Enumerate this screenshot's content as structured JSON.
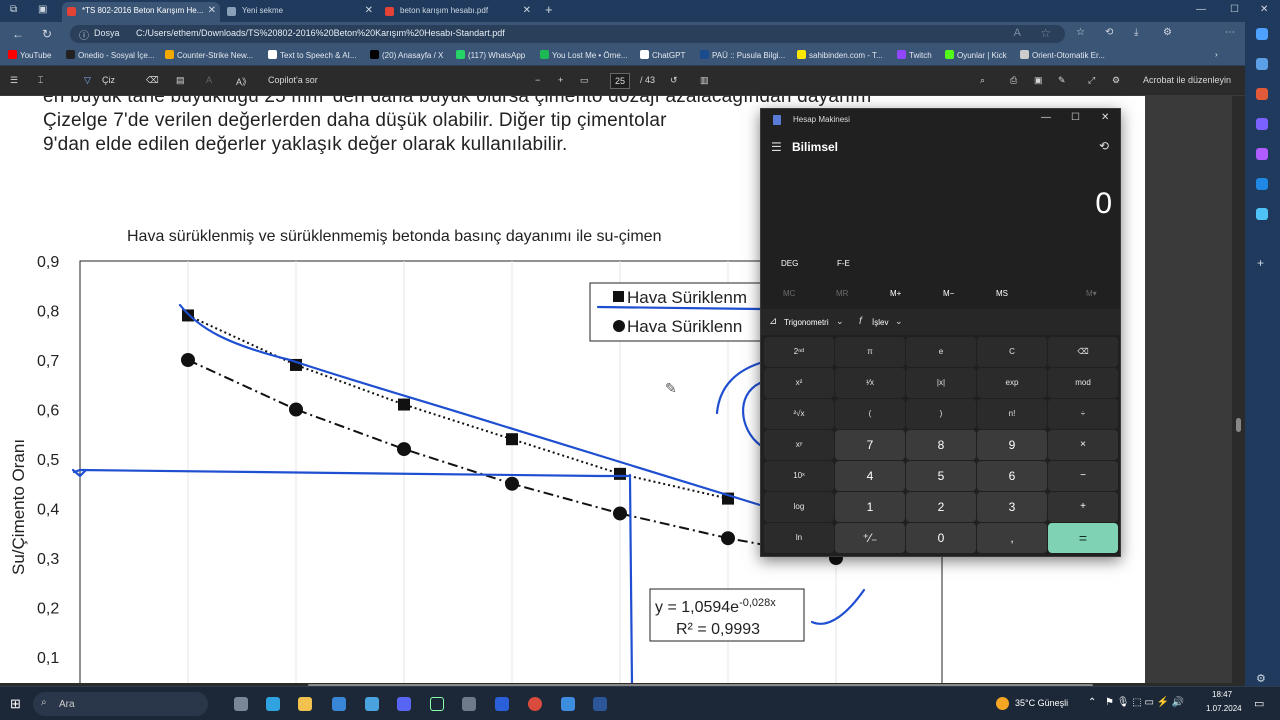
{
  "browser": {
    "tabs": [
      {
        "label": "*TS 802-2016 Beton Karışım He...",
        "active": true,
        "color": "#e34234"
      },
      {
        "label": "Yeni sekme",
        "active": false,
        "color": "#8aa0b8"
      },
      {
        "label": "beton karışım hesabı.pdf",
        "active": false,
        "color": "#e34234"
      }
    ],
    "new_tab": "+",
    "address_label": "Dosya",
    "url": "C:/Users/ethem/Downloads/TS%20802-2016%20Beton%20Karışım%20Hesabı-Standart.pdf",
    "bookmarks": [
      {
        "label": "YouTube",
        "color": "#ff0000"
      },
      {
        "label": "Onedio - Sosyal İçe...",
        "color": "#222222"
      },
      {
        "label": "Counter-Strike New...",
        "color": "#f2a900"
      },
      {
        "label": "Text to Speech & AI...",
        "color": "#ffffff"
      },
      {
        "label": "(20) Anasayfa / X",
        "color": "#000000"
      },
      {
        "label": "(117) WhatsApp",
        "color": "#25d366"
      },
      {
        "label": "You Lost Me • Öme...",
        "color": "#1db954"
      },
      {
        "label": "ChatGPT",
        "color": "#ffffff"
      },
      {
        "label": "PAÜ :: Pusula Bilgi...",
        "color": "#1a4b8c"
      },
      {
        "label": "sahibinden.com - T...",
        "color": "#ffe800"
      },
      {
        "label": "Twitch",
        "color": "#9146ff"
      },
      {
        "label": "Oyunlar | Kick",
        "color": "#53fc18"
      },
      {
        "label": "Orient-Otomatik Er...",
        "color": "#cccccc"
      }
    ]
  },
  "pdf_toolbar": {
    "draw": "Çiz",
    "copilot": "Copilot'a sor",
    "minus": "−",
    "plus": "+",
    "page": "25",
    "total": "/ 43",
    "edit": "Acrobat ile düzenleyin"
  },
  "document": {
    "line1": "en büyük tane büyüklüğü 25 mm' den daha büyük olursa çimento dozajı azalacağından dayanım",
    "line2": "Çizelge 7'de verilen değerlerden daha düşük olabilir. Diğer tip çimentolar",
    "line3": "9'dan elde edilen değerler yaklaşık değer olarak kullanılabilir."
  },
  "chart_data": {
    "type": "scatter",
    "title": "Hava sürüklenmiş ve sürüklenmemiş betonda basınç dayanımı ile su-çimen",
    "ylabel": "Su/Çimento Oranı",
    "xlabel": "",
    "ylim": [
      0.1,
      0.9
    ],
    "yticks": [
      "0,9",
      "0,8",
      "0,7",
      "0,6",
      "0,5",
      "0,4",
      "0,3",
      "0,2",
      "0,1"
    ],
    "x": [
      1,
      2,
      3,
      4,
      5,
      6,
      7
    ],
    "series": [
      {
        "name": "Hava Süriklenm",
        "marker": "square",
        "values": [
          0.79,
          0.69,
          0.61,
          0.54,
          0.47,
          0.42,
          null
        ]
      },
      {
        "name": "Hava Süriklenn",
        "marker": "circle",
        "values": [
          0.7,
          0.6,
          0.52,
          0.45,
          0.39,
          0.34,
          0.3
        ]
      }
    ],
    "equation": "y = 1,0594e",
    "equation_exp": "-0,028x",
    "r2": "R² = 0,9993"
  },
  "calculator": {
    "title": "Hesap Makinesi",
    "mode": "Bilimsel",
    "display": "0",
    "deg": "DEG",
    "fe": "F-E",
    "memory": [
      "MC",
      "MR",
      "M+",
      "M−",
      "MS",
      "M▾"
    ],
    "trig": "Trigonometri",
    "func": "İşlev",
    "keys": [
      [
        "2ⁿᵈ",
        "π",
        "e",
        "C",
        "⌫"
      ],
      [
        "x²",
        "¹⁄x",
        "|x|",
        "exp",
        "mod"
      ],
      [
        "²√x",
        "(",
        ")",
        "n!",
        "÷"
      ],
      [
        "xʸ",
        "7",
        "8",
        "9",
        "×"
      ],
      [
        "10ˣ",
        "4",
        "5",
        "6",
        "−"
      ],
      [
        "log",
        "1",
        "2",
        "3",
        "+"
      ],
      [
        "ln",
        "⁺⁄₋",
        "0",
        ",",
        "="
      ]
    ]
  },
  "taskbar": {
    "search": "Ara",
    "weather": "35°C Güneşli",
    "time": "18:47",
    "date": "1.07.2024"
  }
}
